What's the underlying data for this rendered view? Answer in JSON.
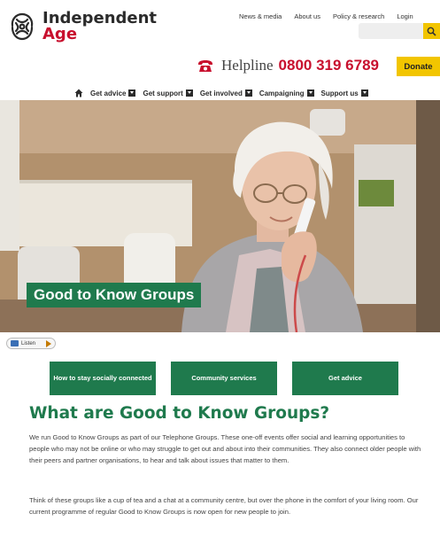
{
  "header": {
    "logo_line1": "Independent",
    "logo_line2": "Age",
    "top_links": [
      "News & media",
      "About us",
      "Policy & research",
      "Login"
    ],
    "search_icon": "search-icon",
    "helpline_label": "Helpline",
    "helpline_number": "0800 319 6789",
    "donate_label": "Donate"
  },
  "nav": {
    "items": [
      "Get advice",
      "Get support",
      "Get involved",
      "Campaigning",
      "Support us"
    ]
  },
  "hero": {
    "title": "Good to Know Groups"
  },
  "listen": {
    "label": "Listen"
  },
  "quick_links": [
    "How to stay socially connected",
    "Community services",
    "Get advice"
  ],
  "content": {
    "heading": "What are Good to Know Groups?",
    "paragraph1": "We run Good to Know Groups as part of our Telephone Groups. These one-off events offer social and learning opportunities to people who may not be online or who may struggle to get out and about into their communities. They also connect older people with their peers and partner organisations, to hear and talk about issues that matter to them.",
    "paragraph2": "Think of these groups like a cup of tea and a chat at a community centre, but over the phone in the comfort of your living room. Our current programme of regular Good to Know Groups is now open for new people to join."
  },
  "colors": {
    "brand_green": "#1f7a4d",
    "brand_red": "#c8102e",
    "accent_yellow": "#f2c500"
  }
}
